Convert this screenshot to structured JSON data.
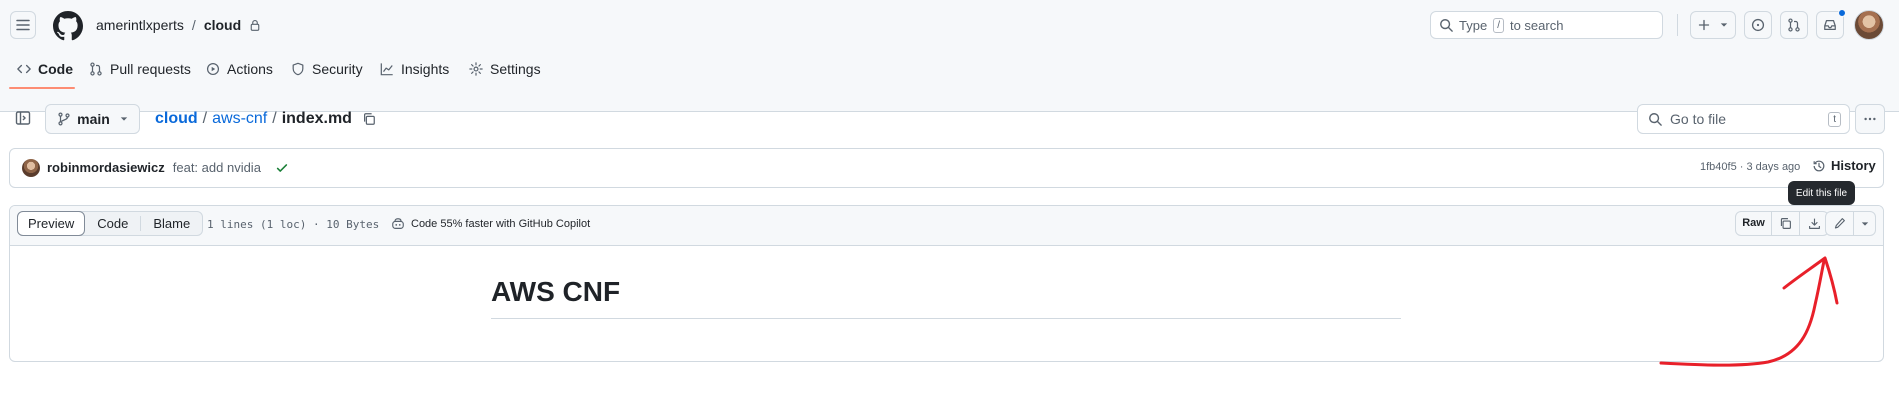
{
  "header": {
    "owner": "amerintlxperts",
    "separator": "/",
    "repo": "cloud",
    "search_prefix": "Type",
    "search_key": "/",
    "search_suffix": "to search"
  },
  "tabs": [
    {
      "label": "Code"
    },
    {
      "label": "Pull requests"
    },
    {
      "label": "Actions"
    },
    {
      "label": "Security"
    },
    {
      "label": "Insights"
    },
    {
      "label": "Settings"
    }
  ],
  "file_nav": {
    "branch": "main",
    "breadcrumb": {
      "root": "cloud",
      "sep1": "/",
      "folder": "aws-cnf",
      "sep2": "/",
      "file": "index.md"
    },
    "goto_placeholder": "Go to file",
    "goto_key": "t"
  },
  "commit": {
    "author": "robinmordasiewicz",
    "message": "feat: add nvidia",
    "sha_time": "1fb40f5 · 3 days ago",
    "history_label": "History"
  },
  "tooltip": {
    "text": "Edit this file"
  },
  "file_toolbar": {
    "segments": [
      "Preview",
      "Code",
      "Blame"
    ],
    "active_segment": "Preview",
    "file_info": "1 lines (1 loc) · 10 Bytes",
    "copilot_text": "Code 55% faster with GitHub Copilot",
    "raw_label": "Raw"
  },
  "content": {
    "heading": "AWS CNF"
  },
  "colors": {
    "accent_link": "#0969da",
    "tab_underline": "#fd8c73",
    "success_check": "#1a7f37",
    "annotation_red": "#e8202a",
    "notification_dot": "#0969da"
  }
}
